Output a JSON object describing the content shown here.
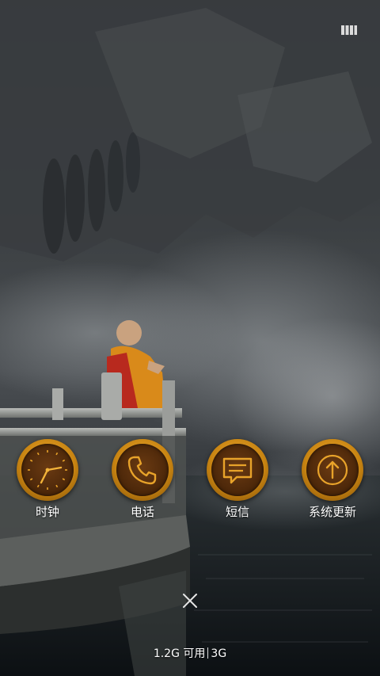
{
  "mode_icon": {
    "icon": "multitask-mode-icon"
  },
  "apps": [
    {
      "label": "时钟",
      "icon": "clock-icon"
    },
    {
      "label": "电话",
      "icon": "phone-icon"
    },
    {
      "label": "短信",
      "icon": "message-icon"
    },
    {
      "label": "系统更新",
      "icon": "system-update-icon"
    }
  ],
  "close": {
    "icon": "close-icon"
  },
  "memory": {
    "available": "1.2G 可用",
    "network": "3G"
  },
  "colors": {
    "gold": "#d08d18",
    "icon_bg": "#4a2609",
    "text": "#ffffff"
  }
}
